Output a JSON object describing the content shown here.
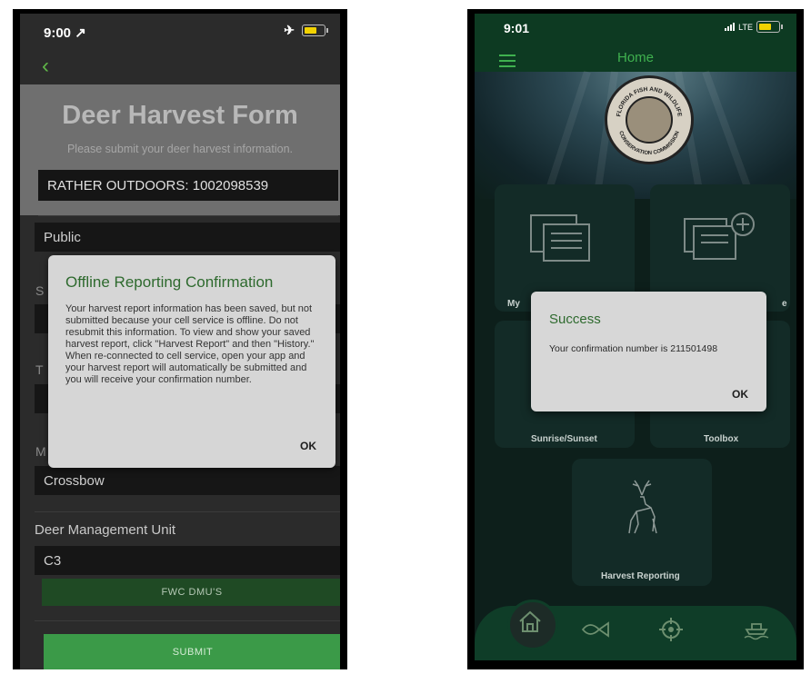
{
  "left_phone": {
    "status": {
      "time": "9:00 ↗"
    },
    "form": {
      "title": "Deer Harvest Form",
      "subtitle": "Please submit your deer harvest information.",
      "customer_id": "RATHER OUTDOORS: 1002098539",
      "land_type_value": "Public",
      "weapon_value": "Crossbow",
      "dmu_label": "Deer Management Unit",
      "dmu_value": "C3",
      "dmu_button": "FWC DMU'S",
      "submit_button": "SUBMIT",
      "partial_letters": {
        "s": "S",
        "t": "T",
        "m": "M"
      }
    },
    "dialog": {
      "title": "Offline Reporting Confirmation",
      "body": "Your harvest report information has been saved, but not submitted because your cell service is offline. Do not resubmit this information. To view and show your saved harvest report, click \"Harvest Report\" and then \"History.\" When re-connected to cell service, open your app and your harvest report will automatically be submitted and you will receive your confirmation number.",
      "ok": "OK"
    }
  },
  "right_phone": {
    "status": {
      "time": "9:01",
      "network": "LTE"
    },
    "header": {
      "title": "Home"
    },
    "seal_text": [
      "FLORIDA FISH AND WILDLIFE",
      "CONSERVATION COMMISSION"
    ],
    "tiles": {
      "my_partial": "My",
      "license_partial": "e",
      "sunrise": "Sunrise/Sunset",
      "toolbox": "Toolbox",
      "harvest": "Harvest Reporting"
    },
    "dialog": {
      "title": "Success",
      "body": "Your confirmation number is 211501498",
      "ok": "OK"
    },
    "nav_icons": [
      "home-icon",
      "fish-icon",
      "target-icon",
      "boat-icon"
    ]
  },
  "colors": {
    "accent_green": "#3fb14f",
    "dialog_title": "#2e6a2e",
    "submit_green": "#3b9a48"
  }
}
